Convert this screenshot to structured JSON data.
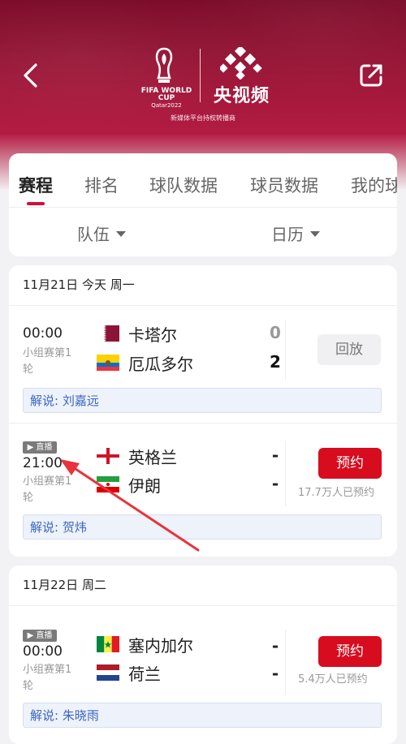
{
  "header": {
    "wc_line1": "FIFA WORLD CUP",
    "wc_line2": "Qatar2022",
    "brand": "央视频",
    "rights": "新媒体平台持权转播商",
    "colors": {
      "bg_dark": "#7b0b28",
      "bg_light": "#b31c42"
    }
  },
  "tabs": [
    {
      "label": "赛程",
      "active": true
    },
    {
      "label": "排名"
    },
    {
      "label": "球队数据"
    },
    {
      "label": "球员数据"
    },
    {
      "label": "我的球"
    }
  ],
  "filters": {
    "team": "队伍",
    "calendar": "日历"
  },
  "days": [
    {
      "date": "11月21日 今天 周一",
      "matches": [
        {
          "time": "00:00",
          "stage": "小组赛第1轮",
          "home": {
            "name": "卡塔尔",
            "score": "0"
          },
          "away": {
            "name": "厄瓜多尔",
            "score": "2"
          },
          "action": "回放",
          "commentary": "解说: 刘嘉远"
        },
        {
          "live_tag": "▶ 直播",
          "time": "21:00",
          "stage": "小组赛第1轮",
          "home": {
            "name": "英格兰",
            "score": "-"
          },
          "away": {
            "name": "伊朗",
            "score": "-"
          },
          "action": "预约",
          "booked": "17.7万人已预约",
          "commentary": "解说: 贺炜"
        }
      ]
    },
    {
      "date": "11月22日 周二",
      "matches": [
        {
          "live_tag": "▶ 直播",
          "time": "00:00",
          "stage": "小组赛第1轮",
          "home": {
            "name": "塞内加尔",
            "score": "-"
          },
          "away": {
            "name": "荷兰",
            "score": "-"
          },
          "action": "预约",
          "booked": "5.4万人已预约",
          "commentary": "解说: 朱晓雨"
        }
      ]
    }
  ],
  "colors": {
    "accent": "#d0103a",
    "book_button": "#d70c1e",
    "commentary_text": "#3a66c4",
    "annotation_arrow": "#e8333b"
  }
}
